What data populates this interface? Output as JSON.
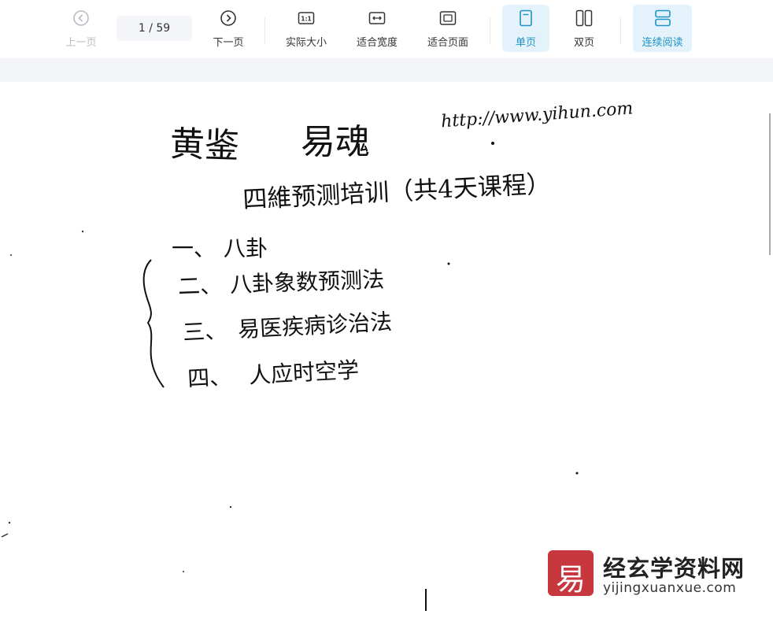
{
  "toolbar": {
    "prev_label": "上一页",
    "next_label": "下一页",
    "page_current": "1",
    "page_total": "/ 59",
    "actual_size_label": "实际大小",
    "fit_width_label": "适合宽度",
    "fit_page_label": "适合页面",
    "single_page_label": "单页",
    "double_page_label": "双页",
    "continuous_label": "连续阅读",
    "actual_size_icon_text": "1:1",
    "accent_color": "#1f93c8"
  },
  "document": {
    "title_left": "黄鉴",
    "title_right": "易魂",
    "url": "http://www.yihun.com",
    "heading": "四維预测培训（共4天课程）",
    "items": [
      {
        "num": "一、",
        "text": "八卦"
      },
      {
        "num": "二、",
        "text": "八卦象数预测法"
      },
      {
        "num": "三、",
        "text": "易医疾病诊治法"
      },
      {
        "num": "四、",
        "text": "人应时空学"
      }
    ]
  },
  "watermark": {
    "logo_char": "易",
    "name": "经玄学资料网",
    "url": "yijingxuanxue.com"
  }
}
